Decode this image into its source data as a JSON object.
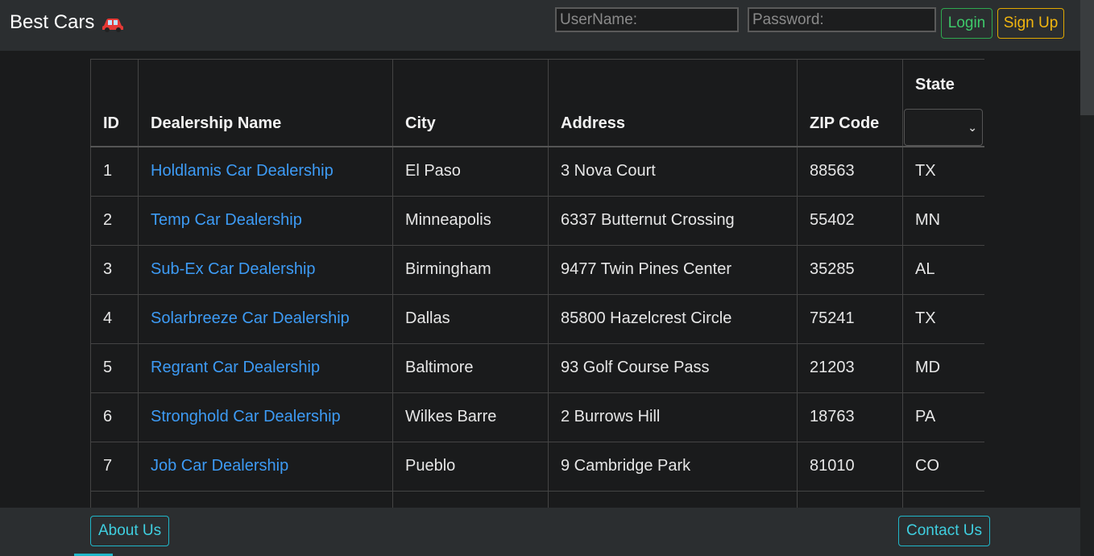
{
  "brand": {
    "title": "Best Cars",
    "icon": "car-icon",
    "icon_color": "#e53935"
  },
  "auth": {
    "username_placeholder": "UserName:",
    "password_placeholder": "Password:",
    "login_label": "Login",
    "signup_label": "Sign Up"
  },
  "table": {
    "columns": [
      "ID",
      "Dealership Name",
      "City",
      "Address",
      "ZIP Code",
      "State"
    ],
    "state_filter_value": "",
    "rows": [
      {
        "id": "1",
        "name": "Holdlamis Car Dealership",
        "city": "El Paso",
        "address": "3 Nova Court",
        "zip": "88563",
        "state": "TX"
      },
      {
        "id": "2",
        "name": "Temp Car Dealership",
        "city": "Minneapolis",
        "address": "6337 Butternut Crossing",
        "zip": "55402",
        "state": "MN"
      },
      {
        "id": "3",
        "name": "Sub-Ex Car Dealership",
        "city": "Birmingham",
        "address": "9477 Twin Pines Center",
        "zip": "35285",
        "state": "AL"
      },
      {
        "id": "4",
        "name": "Solarbreeze Car Dealership",
        "city": "Dallas",
        "address": "85800 Hazelcrest Circle",
        "zip": "75241",
        "state": "TX"
      },
      {
        "id": "5",
        "name": "Regrant Car Dealership",
        "city": "Baltimore",
        "address": "93 Golf Course Pass",
        "zip": "21203",
        "state": "MD"
      },
      {
        "id": "6",
        "name": "Stronghold Car Dealership",
        "city": "Wilkes Barre",
        "address": "2 Burrows Hill",
        "zip": "18763",
        "state": "PA"
      },
      {
        "id": "7",
        "name": "Job Car Dealership",
        "city": "Pueblo",
        "address": "9 Cambridge Park",
        "zip": "81010",
        "state": "CO"
      }
    ]
  },
  "footer": {
    "about_label": "About Us",
    "contact_label": "Contact Us"
  },
  "colors": {
    "link": "#3d9bf5",
    "login": "#3ec96a",
    "signup": "#f2b60f",
    "footer_button": "#3fcfe0",
    "background": "#1a1b1c",
    "bar": "#2b2e30"
  }
}
